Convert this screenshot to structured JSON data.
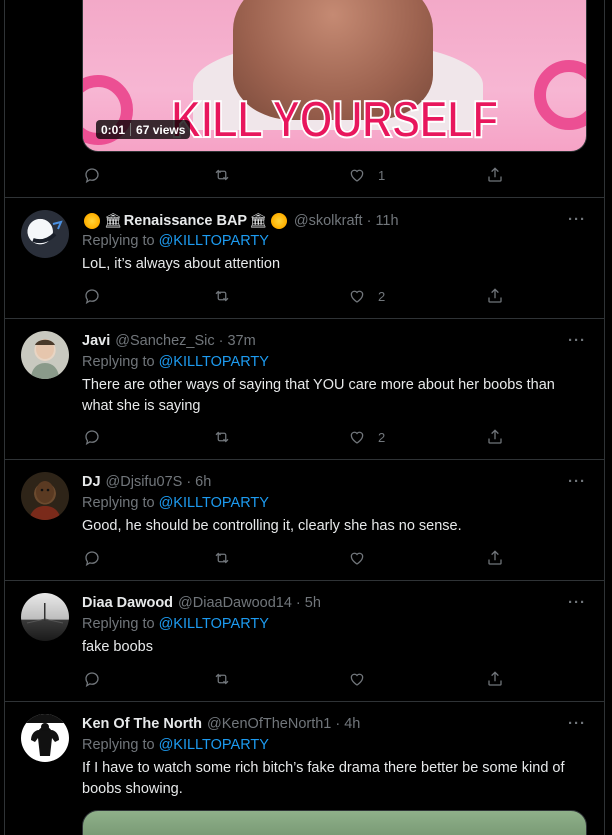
{
  "top_tweet": {
    "media_caption": "KILL YOURSELF",
    "video_time": "0:01",
    "video_views": "67 views",
    "reply_count": "",
    "retweet_count": "",
    "like_count": "1"
  },
  "replies": [
    {
      "name": "Renaissance BAP",
      "handle": "@skolkraft",
      "time": "11h",
      "replying_prefix": "Replying to",
      "replying_to": "@KILLTOPARTY",
      "text": "LoL, it’s always about attention",
      "like_count": "2"
    },
    {
      "name": "Javi",
      "handle": "@Sanchez_Sic",
      "time": "37m",
      "replying_prefix": "Replying to",
      "replying_to": "@KILLTOPARTY",
      "text": "There are other ways of saying that YOU care more about her boobs  than what she is saying",
      "like_count": "2"
    },
    {
      "name": "DJ",
      "handle": "@Djsifu07S",
      "time": "6h",
      "replying_prefix": "Replying to",
      "replying_to": "@KILLTOPARTY",
      "text": "Good, he should be controlling it, clearly she has no sense.",
      "like_count": ""
    },
    {
      "name": "Diaa Dawood",
      "handle": "@DiaaDawood14",
      "time": "5h",
      "replying_prefix": "Replying to",
      "replying_to": "@KILLTOPARTY",
      "text": "fake boobs",
      "like_count": ""
    },
    {
      "name": "Ken Of The North",
      "handle": "@KenOfTheNorth1",
      "time": "4h",
      "replying_prefix": "Replying to",
      "replying_to": "@KILLTOPARTY",
      "text": "If I have to watch some rich bitch’s fake drama there better be some kind of boobs showing."
    }
  ],
  "more_label": "···",
  "dot": "·",
  "colors": {
    "background": "#000000",
    "border": "#2f3336",
    "text_primary": "#e7e9ea",
    "text_secondary": "#71767b",
    "link": "#1d9bf0"
  },
  "icons": [
    "reply-icon",
    "retweet-icon",
    "like-icon",
    "share-icon",
    "more-icon",
    "sun-emoji",
    "classical-building-emoji"
  ]
}
